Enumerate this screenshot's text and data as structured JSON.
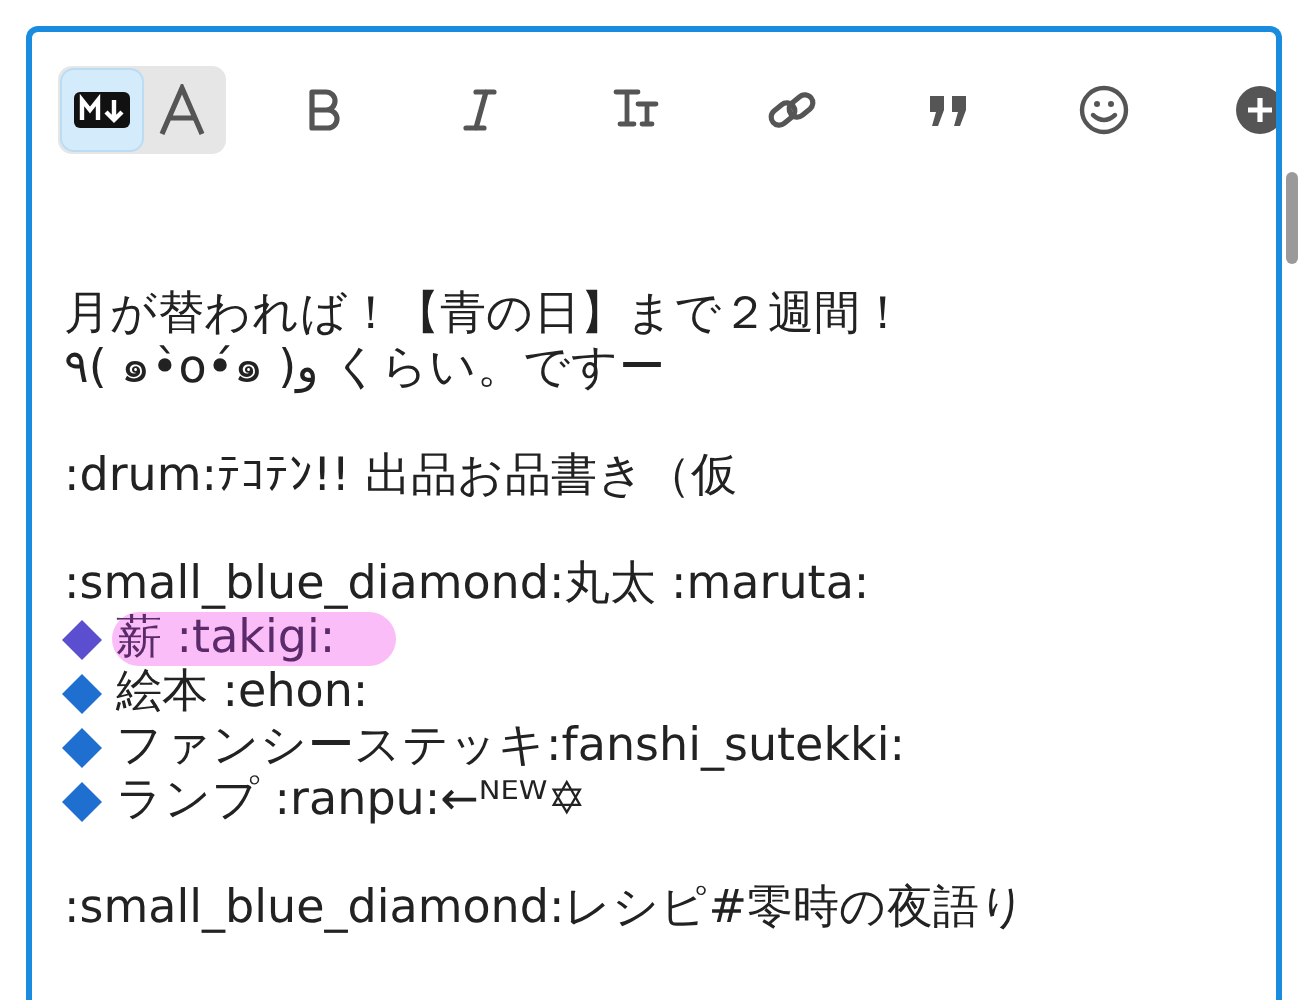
{
  "toolbar": {
    "modes": [
      {
        "kind": "markdown",
        "selected": true
      },
      {
        "kind": "rich",
        "selected": false
      }
    ],
    "tools": [
      {
        "kind": "bold"
      },
      {
        "kind": "italic"
      },
      {
        "kind": "heading"
      },
      {
        "kind": "link"
      },
      {
        "kind": "quote"
      },
      {
        "kind": "emoji"
      },
      {
        "kind": "add"
      }
    ]
  },
  "paragraphs": [
    {
      "lines": [
        {
          "kind": "text",
          "text": "月が替われば！【青の日】まで２週間！",
          "highlighted": false
        },
        {
          "kind": "text",
          "text": "٩( ๑•̀o•́๑ )و くらい。ですー",
          "highlighted": false
        }
      ]
    },
    {
      "lines": [
        {
          "kind": "text",
          "text": ":drum:ﾃｺﾃﾝ!! 出品お品書き（仮",
          "highlighted": false
        }
      ]
    },
    {
      "lines": [
        {
          "kind": "text",
          "text": ":small_blue_diamond:丸太 :maruta:",
          "highlighted": false
        },
        {
          "kind": "bullet",
          "text": "薪 :takigi:",
          "highlighted": true
        },
        {
          "kind": "bullet",
          "text": "絵本 :ehon:",
          "highlighted": false
        },
        {
          "kind": "bullet",
          "text": "ファンシーステッキ:fanshi_sutekki:",
          "highlighted": false
        },
        {
          "kind": "bullet",
          "text": "ランプ :ranpu:←ᴺᴱᵂ✡",
          "highlighted": false
        }
      ]
    },
    {
      "lines": [
        {
          "kind": "text",
          "text": ":small_blue_diamond:レシピ#零時の夜語り",
          "highlighted": false
        }
      ]
    }
  ]
}
